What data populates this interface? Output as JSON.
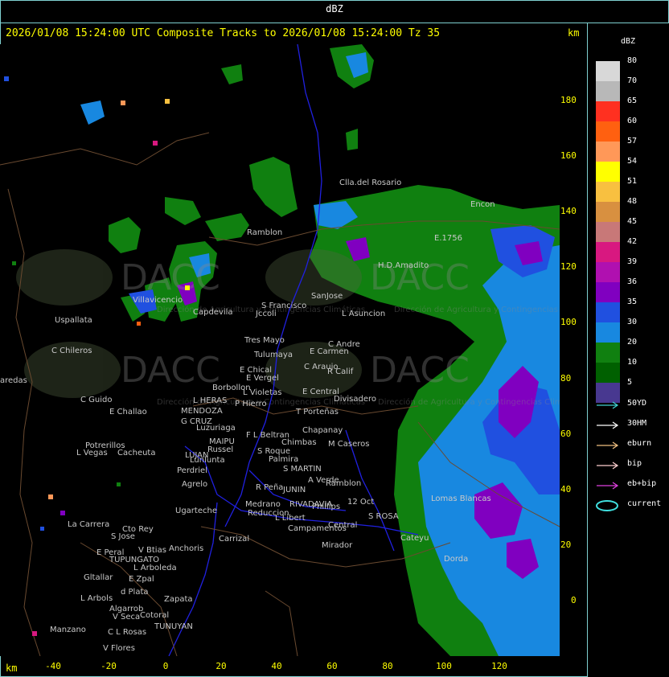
{
  "window": {
    "title": "dBZ"
  },
  "header": {
    "text": "2026/01/08 15:24:00 UTC Composite Tracks to 2026/01/08 15:24:00 Tz 35",
    "unit_top": "km",
    "unit_bottom": "km"
  },
  "axes": {
    "x_ticks": [
      "-40",
      "-20",
      "0",
      "20",
      "40",
      "60",
      "80",
      "100",
      "120"
    ],
    "y_ticks": [
      "180",
      "160",
      "140",
      "120",
      "100",
      "80",
      "60",
      "40",
      "20",
      "0"
    ]
  },
  "legend": {
    "title": "dBZ",
    "scale": [
      {
        "label": "80",
        "color": "#d8d8d8"
      },
      {
        "label": "70",
        "color": "#b8b8b8"
      },
      {
        "label": "65",
        "color": "#ff3020"
      },
      {
        "label": "60",
        "color": "#ff6010"
      },
      {
        "label": "57",
        "color": "#ff9858"
      },
      {
        "label": "54",
        "color": "#ffff00"
      },
      {
        "label": "51",
        "color": "#f8c040"
      },
      {
        "label": "48",
        "color": "#d89040"
      },
      {
        "label": "45",
        "color": "#c87878"
      },
      {
        "label": "42",
        "color": "#d81880"
      },
      {
        "label": "39",
        "color": "#b010b0"
      },
      {
        "label": "36",
        "color": "#8000c0"
      },
      {
        "label": "35",
        "color": "#2050e0"
      },
      {
        "label": "30",
        "color": "#1888e0"
      },
      {
        "label": "20",
        "color": "#108010"
      },
      {
        "label": "10",
        "color": "#006000"
      },
      {
        "label": "5",
        "color": "#483890"
      }
    ],
    "tracks": [
      {
        "label": "50YD",
        "color": "#40d0d0"
      },
      {
        "label": "30HM",
        "color": "#ffffff"
      },
      {
        "label": "eburn",
        "color": "#f0c080"
      },
      {
        "label": "bip",
        "color": "#ffd0d0"
      },
      {
        "label": "eb+bip",
        "color": "#e040e0"
      },
      {
        "label": "current",
        "color": "#40e0e0"
      }
    ]
  },
  "map": {
    "watermark": "DACC",
    "watermark_sub": "Dirección de Agricultura y Contingencias Climáticas",
    "places": [
      "Clla.del Rosario",
      "Encon",
      "E.1756",
      "Ramblon",
      "H.D.Amadito",
      "Villavicencio",
      "Capdevila",
      "S Francisco",
      "Jccoli",
      "SanJose",
      "L Asuncion",
      "Uspallata",
      "C Chileros",
      "Tres Mayo",
      "Tulumaya",
      "C Andre",
      "E Carmen",
      "E Chical",
      "E Vergel",
      "C Araujo",
      "R Calif",
      "Borbollon",
      "L Violetas",
      "E Central",
      "Divisadero",
      "L HERAS",
      "P Hierro",
      "T Porteñas",
      "C Guido",
      "E Challao",
      "MENDOZA",
      "G CRUZ",
      "Luzuriaga",
      "F L Beltran",
      "Chapanay",
      "MAIPU",
      "Russel",
      "Chimbas",
      "M Caseros",
      "Potrerillos",
      "L Vegas",
      "Cacheuta",
      "LUJAN",
      "S Roque",
      "Palmira",
      "Lunlunta",
      "Perdriel",
      "S MARTIN",
      "A Verde",
      "Ramblon",
      "Agrelo",
      "R Peña",
      "JUNIN",
      "Medrano",
      "RIVADAVIA",
      "Phillips",
      "12 Oct",
      "S ROSA",
      "Lomas Blancas",
      "Ugarteche",
      "Reduccion",
      "L Libert",
      "Campamentos",
      "Central",
      "La Carrera",
      "Cto Rey",
      "S Jose",
      "Carrizal",
      "Cateyu",
      "E Peral",
      "V Btias",
      "Anchoris",
      "Mirador",
      "TUPUNGATO",
      "L Arboleda",
      "Dorda",
      "Gltallar",
      "E Zpal",
      "d Plata",
      "L Arbols",
      "Zapata",
      "Algarrob",
      "V Seca",
      "Cotoral",
      "TUNUYAN",
      "Manzano",
      "C L Rosas",
      "V Flores",
      "aredas"
    ]
  }
}
